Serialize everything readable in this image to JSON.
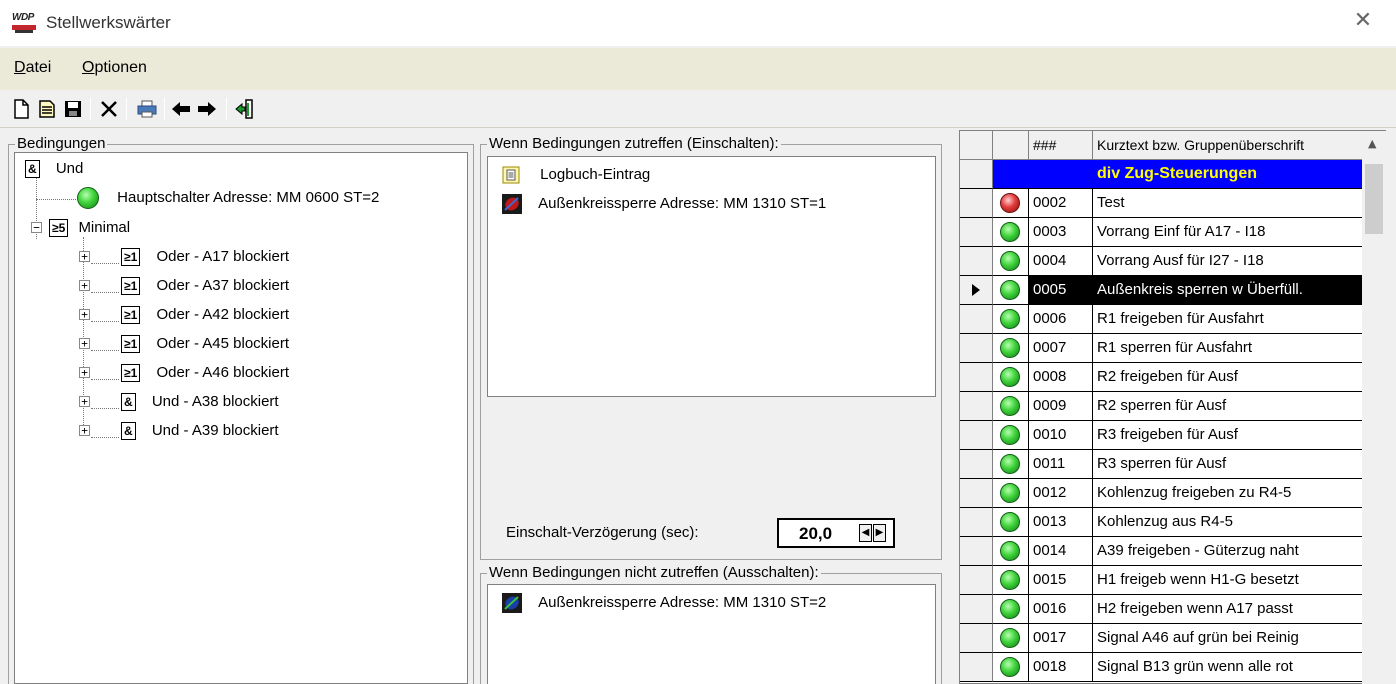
{
  "window": {
    "title": "Stellwerkswärter",
    "logo_text": "WDP",
    "close_glyph": "✕"
  },
  "menu": [
    {
      "label": "Datei",
      "accel": "D",
      "rest": "atei"
    },
    {
      "label": "Optionen",
      "accel": "O",
      "rest": "ptionen"
    }
  ],
  "toolbar": [
    "new-icon",
    "open-icon",
    "save-icon",
    "delete-icon",
    "print-icon",
    "back-arrow-icon",
    "forward-arrow-icon",
    "exit-icon"
  ],
  "conditions": {
    "group_label": "Bedingungen",
    "root": {
      "gate": "&",
      "label": "Und"
    },
    "main_switch": "Hauptschalter Adresse: MM 0600 ST=2",
    "minimal": {
      "gate": "≥5",
      "label": "Minimal"
    },
    "items": [
      {
        "gate": "≥1",
        "label": "Oder - A17 blockiert"
      },
      {
        "gate": "≥1",
        "label": "Oder - A37 blockiert"
      },
      {
        "gate": "≥1",
        "label": "Oder - A42 blockiert"
      },
      {
        "gate": "≥1",
        "label": "Oder - A45 blockiert"
      },
      {
        "gate": "≥1",
        "label": "Oder - A46 blockiert"
      },
      {
        "gate": "&",
        "label": "Und - A38 blockiert"
      },
      {
        "gate": "&",
        "label": "Und - A39 blockiert"
      }
    ]
  },
  "on_actions": {
    "group_label": "Wenn Bedingungen zutreffen (Einschalten):",
    "items": [
      "Logbuch-Eintrag",
      "Außenkreissperre Adresse: MM 1310 ST=1"
    ],
    "delay_label": "Einschalt-Verzögerung (sec):",
    "delay_value": "20,0"
  },
  "off_actions": {
    "group_label": "Wenn Bedingungen nicht zutreffen (Ausschalten):",
    "items": [
      "Außenkreissperre Adresse: MM 1310 ST=2"
    ]
  },
  "grid": {
    "headers": [
      "###",
      "Kurztext bzw. Gruppenüberschrift"
    ],
    "group_title": "div Zug-Steuerungen",
    "selected_id": "0005",
    "rows": [
      {
        "id": "0002",
        "text": "Test",
        "state": "red"
      },
      {
        "id": "0003",
        "text": "Vorrang Einf für A17 - I18",
        "state": "green"
      },
      {
        "id": "0004",
        "text": "Vorrang Ausf für I27 - I18",
        "state": "green"
      },
      {
        "id": "0005",
        "text": "Außenkreis sperren w Überfüll.",
        "state": "green"
      },
      {
        "id": "0006",
        "text": "R1 freigeben für Ausfahrt",
        "state": "green"
      },
      {
        "id": "0007",
        "text": "R1 sperren für Ausfahrt",
        "state": "green"
      },
      {
        "id": "0008",
        "text": "R2 freigeben für Ausf",
        "state": "green"
      },
      {
        "id": "0009",
        "text": "R2 sperren für Ausf",
        "state": "green"
      },
      {
        "id": "0010",
        "text": "R3 freigeben für Ausf",
        "state": "green"
      },
      {
        "id": "0011",
        "text": "R3 sperren für Ausf",
        "state": "green"
      },
      {
        "id": "0012",
        "text": "Kohlenzug freigeben zu R4-5",
        "state": "green"
      },
      {
        "id": "0013",
        "text": "Kohlenzug aus R4-5",
        "state": "green"
      },
      {
        "id": "0014",
        "text": "A39 freigeben - Güterzug naht",
        "state": "green"
      },
      {
        "id": "0015",
        "text": "H1 freigeb wenn H1-G besetzt",
        "state": "green"
      },
      {
        "id": "0016",
        "text": "H2 freigeben wenn A17 passt",
        "state": "green"
      },
      {
        "id": "0017",
        "text": "Signal A46 auf grün bei Reinig",
        "state": "green"
      },
      {
        "id": "0018",
        "text": "Signal B13 grün wenn alle rot",
        "state": "green"
      }
    ],
    "colors": {
      "group_bg": "#0000ff",
      "group_fg": "#ffff00",
      "selected_bg": "#000000",
      "selected_fg": "#ffffff"
    }
  }
}
